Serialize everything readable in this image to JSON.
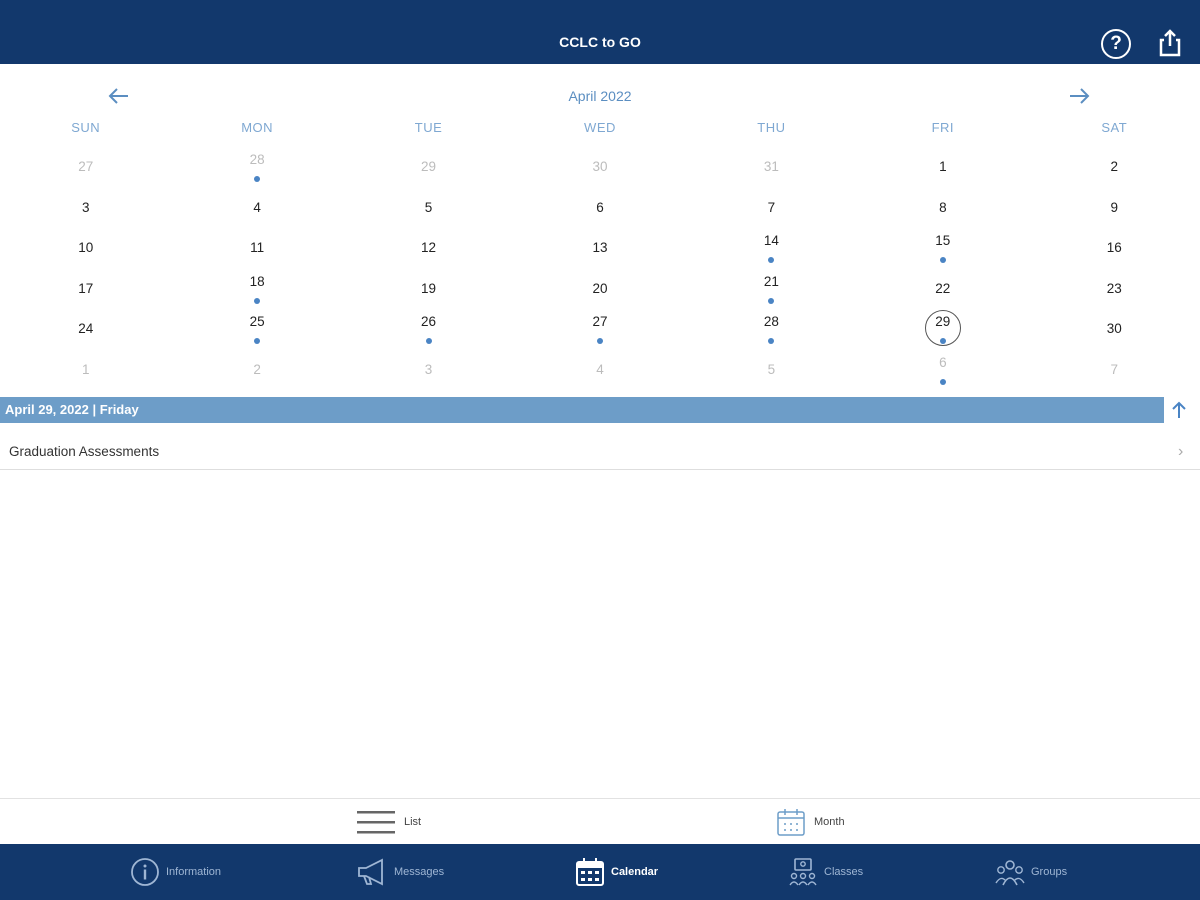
{
  "app": {
    "title": "CCLC to GO"
  },
  "header": {
    "help_icon": "help-circle-icon",
    "share_icon": "share-icon"
  },
  "calendar": {
    "month_label": "April 2022",
    "weekdays": [
      "SUN",
      "MON",
      "TUE",
      "WED",
      "THU",
      "FRI",
      "SAT"
    ],
    "weeks": [
      [
        {
          "d": "27",
          "muted": true
        },
        {
          "d": "28",
          "muted": true,
          "dot": true
        },
        {
          "d": "29",
          "muted": true
        },
        {
          "d": "30",
          "muted": true
        },
        {
          "d": "31",
          "muted": true
        },
        {
          "d": "1"
        },
        {
          "d": "2"
        }
      ],
      [
        {
          "d": "3"
        },
        {
          "d": "4"
        },
        {
          "d": "5"
        },
        {
          "d": "6"
        },
        {
          "d": "7"
        },
        {
          "d": "8"
        },
        {
          "d": "9"
        }
      ],
      [
        {
          "d": "10"
        },
        {
          "d": "11"
        },
        {
          "d": "12"
        },
        {
          "d": "13"
        },
        {
          "d": "14",
          "dot": true
        },
        {
          "d": "15",
          "dot": true
        },
        {
          "d": "16"
        }
      ],
      [
        {
          "d": "17"
        },
        {
          "d": "18",
          "dot": true
        },
        {
          "d": "19"
        },
        {
          "d": "20"
        },
        {
          "d": "21",
          "dot": true
        },
        {
          "d": "22"
        },
        {
          "d": "23"
        }
      ],
      [
        {
          "d": "24"
        },
        {
          "d": "25",
          "dot": true
        },
        {
          "d": "26",
          "dot": true
        },
        {
          "d": "27",
          "dot": true
        },
        {
          "d": "28",
          "dot": true
        },
        {
          "d": "29",
          "dot": true,
          "selected": true
        },
        {
          "d": "30"
        }
      ],
      [
        {
          "d": "1",
          "muted": true
        },
        {
          "d": "2",
          "muted": true
        },
        {
          "d": "3",
          "muted": true
        },
        {
          "d": "4",
          "muted": true
        },
        {
          "d": "5",
          "muted": true
        },
        {
          "d": "6",
          "muted": true,
          "dot": true
        },
        {
          "d": "7",
          "muted": true
        }
      ]
    ]
  },
  "selected_day": {
    "label": "April 29, 2022 | Friday"
  },
  "events": [
    {
      "name": "Graduation Assessments"
    }
  ],
  "view_options": {
    "list_label": "List",
    "month_label": "Month"
  },
  "tabs": [
    {
      "label": "Information",
      "icon": "info-icon"
    },
    {
      "label": "Messages",
      "icon": "megaphone-icon"
    },
    {
      "label": "Calendar",
      "icon": "calendar-icon",
      "active": true
    },
    {
      "label": "Classes",
      "icon": "classes-icon"
    },
    {
      "label": "Groups",
      "icon": "groups-icon"
    }
  ],
  "colors": {
    "header_bg": "#12386c",
    "accent": "#5b8ec1",
    "selected_bar": "#6d9dc8",
    "dot": "#4a84c4"
  }
}
